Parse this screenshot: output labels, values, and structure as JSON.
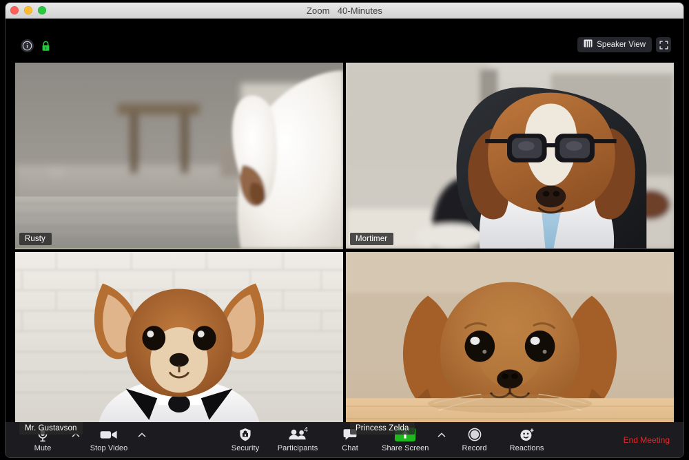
{
  "window": {
    "title": "Zoom   40-Minutes",
    "traffic_lights": [
      "close",
      "minimize",
      "maximize"
    ]
  },
  "top_bar": {
    "info_icon": "info-circle-icon",
    "encryption_icon": "green-lock-icon",
    "view_button": {
      "label": "Speaker View",
      "icon": "grid-view-icon"
    },
    "fullscreen_icon": "fullscreen-expand-icon"
  },
  "video_grid": {
    "active_border_color": "#cddc39",
    "tiles": [
      {
        "name": "Rusty",
        "active_speaker": true,
        "description": "white dog tail in front of a blurred living room with grey carpet"
      },
      {
        "name": "Mortimer",
        "active_speaker": false,
        "description": "beagle wearing black glasses, white shirt and light blue necktie at a desk"
      },
      {
        "name": "Mr. Gustavson",
        "active_speaker": false,
        "description": "chihuahua wearing a white shirt and black bow tie against white brick wall"
      },
      {
        "name": "Princess Zelda",
        "active_speaker": false,
        "description": "cavalier king charles spaniel resting its head on a wooden table"
      }
    ]
  },
  "toolbar": {
    "mute": {
      "label": "Mute",
      "icon": "microphone-icon",
      "has_chevron": true
    },
    "video": {
      "label": "Stop Video",
      "icon": "video-camera-icon",
      "has_chevron": true
    },
    "security": {
      "label": "Security",
      "icon": "shield-icon"
    },
    "participants": {
      "label": "Participants",
      "icon": "participants-icon",
      "count": "4"
    },
    "chat": {
      "label": "Chat",
      "icon": "chat-bubble-icon"
    },
    "share_screen": {
      "label": "Share Screen",
      "icon": "share-screen-up-arrow-icon",
      "has_chevron": true,
      "accent_color": "#1eb91e"
    },
    "record": {
      "label": "Record",
      "icon": "record-circle-icon"
    },
    "reactions": {
      "label": "Reactions",
      "icon": "smiley-plus-icon"
    },
    "end_meeting": {
      "label": "End Meeting",
      "color": "#e02b2b"
    }
  }
}
